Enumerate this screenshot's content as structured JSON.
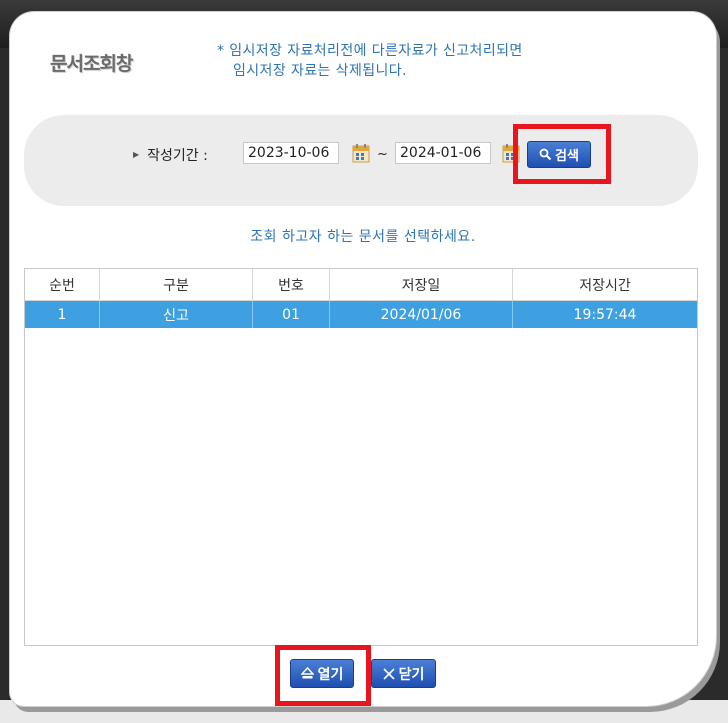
{
  "window": {
    "title": "문서조회창",
    "notice_line1": "* 임시저장 자료처리전에 다른자료가 신고처리되면",
    "notice_line2": "임시저장 자료는 삭제됩니다."
  },
  "search": {
    "period_label": "작성기간 :",
    "start_date": "2023-10-06",
    "end_date": "2024-01-06",
    "separator": "~",
    "search_label": "검색"
  },
  "instruction": "조회 하고자 하는 문서를 선택하세요.",
  "table": {
    "columns": [
      "순번",
      "구분",
      "번호",
      "저장일",
      "저장시간"
    ],
    "rows": [
      [
        "1",
        "신고",
        "01",
        "2024/01/06",
        "19:57:44"
      ]
    ],
    "selected_row_color": "#3ea0e0"
  },
  "buttons": {
    "open_label": "열기",
    "close_label": "닫기"
  },
  "colors": {
    "accent_blue": "#2f74b5",
    "button_blue": "#1f4fb0",
    "highlight_red": "#e8141e"
  }
}
